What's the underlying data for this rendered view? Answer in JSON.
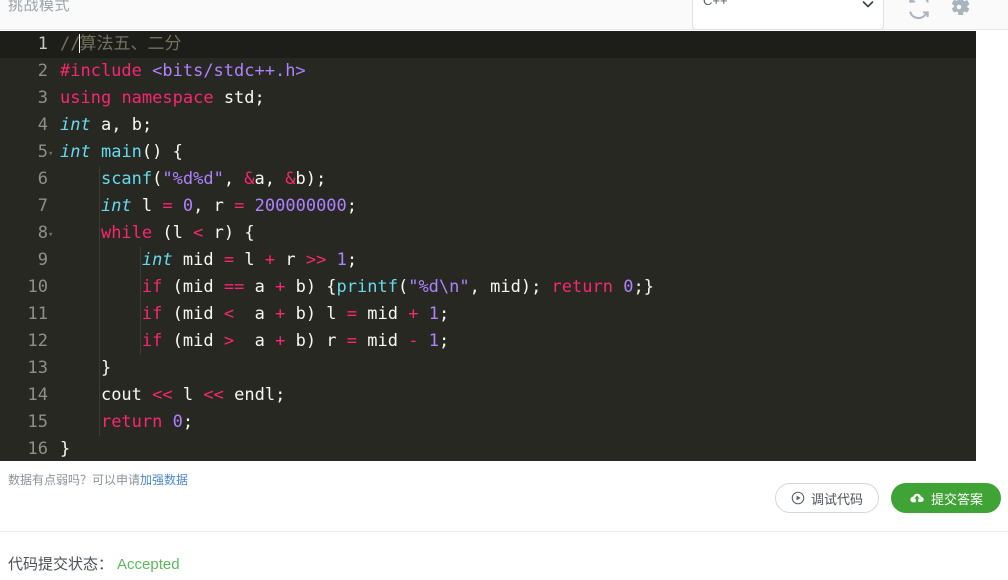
{
  "topbar": {
    "mode_label": "挑战模式",
    "language": {
      "value": "C++",
      "icon": "chevron-down-icon"
    },
    "refresh_icon": "refresh-icon",
    "settings_icon": "gear-icon"
  },
  "editor": {
    "language": "cpp",
    "theme": "monokai",
    "active_line": 1,
    "total_lines": 16,
    "lines": [
      {
        "n": "1",
        "fold": false,
        "text": "//算法五、二分"
      },
      {
        "n": "2",
        "fold": false,
        "text": "#include <bits/stdc++.h>"
      },
      {
        "n": "3",
        "fold": false,
        "text": "using namespace std;"
      },
      {
        "n": "4",
        "fold": false,
        "text": "int a, b;"
      },
      {
        "n": "5",
        "fold": true,
        "text": "int main() {"
      },
      {
        "n": "6",
        "fold": false,
        "text": "    scanf(\"%d%d\", &a, &b);"
      },
      {
        "n": "7",
        "fold": false,
        "text": "    int l = 0, r = 200000000;"
      },
      {
        "n": "8",
        "fold": true,
        "text": "    while (l < r) {"
      },
      {
        "n": "9",
        "fold": false,
        "text": "        int mid = l + r >> 1;"
      },
      {
        "n": "10",
        "fold": false,
        "text": "        if (mid == a + b) {printf(\"%d\\n\", mid); return 0;}"
      },
      {
        "n": "11",
        "fold": false,
        "text": "        if (mid <  a + b) l = mid + 1;"
      },
      {
        "n": "12",
        "fold": false,
        "text": "        if (mid >  a + b) r = mid - 1;"
      },
      {
        "n": "13",
        "fold": false,
        "text": "    }"
      },
      {
        "n": "14",
        "fold": false,
        "text": "    cout << l << endl;"
      },
      {
        "n": "15",
        "fold": false,
        "text": "    return 0;"
      },
      {
        "n": "16",
        "fold": false,
        "text": "}"
      }
    ]
  },
  "footer": {
    "hint_prefix": "数据有点弱吗？可以申请",
    "hint_link": "加强数据",
    "debug_button": {
      "label": "调试代码",
      "icon": "play-circle-icon"
    },
    "submit_button": {
      "label": "提交答案",
      "icon": "upload-cloud-icon"
    }
  },
  "status": {
    "label": "代码提交状态：",
    "value": "Accepted",
    "color": "#5cb85c"
  }
}
